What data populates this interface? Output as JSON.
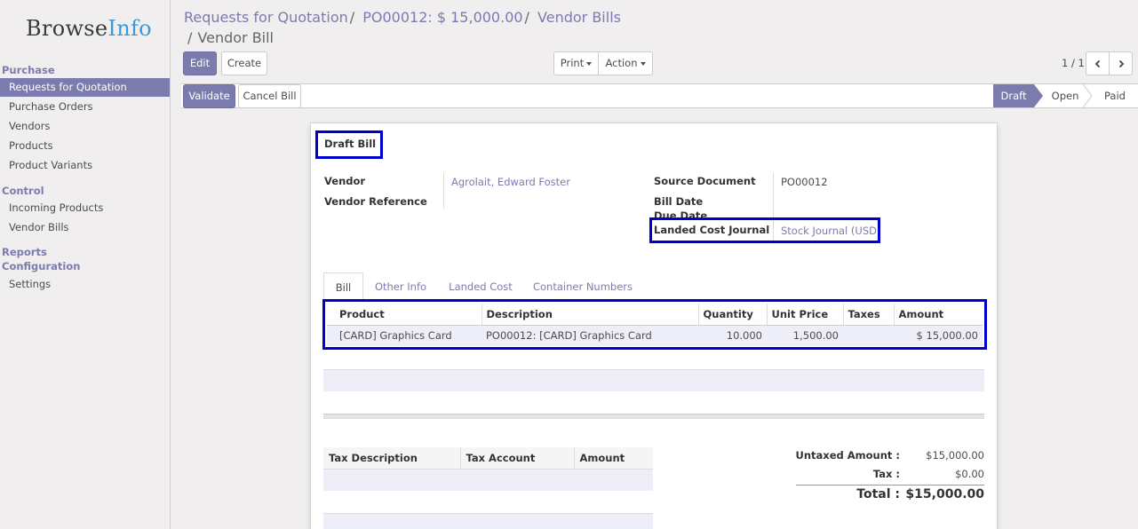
{
  "app": {
    "logo_main": "Browse",
    "logo_accent": "Info"
  },
  "sidebar": {
    "purchase_header": "Purchase",
    "items": [
      {
        "label": "Requests for Quotation"
      },
      {
        "label": "Purchase Orders"
      },
      {
        "label": "Vendors"
      },
      {
        "label": "Products"
      },
      {
        "label": "Product Variants"
      }
    ],
    "control_header": "Control",
    "control_items": [
      {
        "label": "Incoming Products"
      },
      {
        "label": "Vendor Bills"
      }
    ],
    "reports_header": "Reports",
    "configuration_header": "Configuration",
    "config_items": [
      {
        "label": "Settings"
      }
    ]
  },
  "breadcrumb": {
    "items": [
      "Requests for Quotation",
      "PO00012: $ 15,000.00",
      "Vendor Bills"
    ],
    "separator": "/",
    "current": "Vendor Bill"
  },
  "toolbar": {
    "edit": "Edit",
    "create": "Create",
    "print": "Print",
    "action": "Action",
    "pager": "1 / 1"
  },
  "statusbar": {
    "validate": "Validate",
    "cancel_bill": "Cancel Bill",
    "stages": [
      "Draft",
      "Open",
      "Paid"
    ]
  },
  "form": {
    "title": "Draft Bill",
    "vendor_label": "Vendor",
    "vendor_value": "Agrolait, Edward Foster",
    "vendor_ref_label": "Vendor Reference",
    "source_doc_label": "Source Document",
    "source_doc_value": "PO00012",
    "bill_date_label": "Bill Date",
    "due_date_label": "Due Date",
    "landed_cost_journal_label": "Landed Cost Journal",
    "landed_cost_journal_value": "Stock Journal (USD)"
  },
  "tabs": [
    "Bill",
    "Other Info",
    "Landed Cost",
    "Container Numbers"
  ],
  "lines": {
    "headers": [
      "Product",
      "Description",
      "Quantity",
      "Unit Price",
      "Taxes",
      "Amount"
    ],
    "rows": [
      [
        "[CARD] Graphics Card",
        "PO00012: [CARD] Graphics Card",
        "10.000",
        "1,500.00",
        "",
        "$ 15,000.00"
      ]
    ]
  },
  "tax_table": {
    "headers": [
      "Tax Description",
      "Tax Account",
      "Amount"
    ]
  },
  "totals": {
    "untaxed_label": "Untaxed Amount :",
    "untaxed_value": "$15,000.00",
    "tax_label": "Tax :",
    "tax_value": "$0.00",
    "total_label": "Total :",
    "total_value": "$15,000.00"
  },
  "colors": {
    "accent": "#7c7bad",
    "highlight": "#0000cc",
    "logo_accent": "#3a9ad9"
  }
}
